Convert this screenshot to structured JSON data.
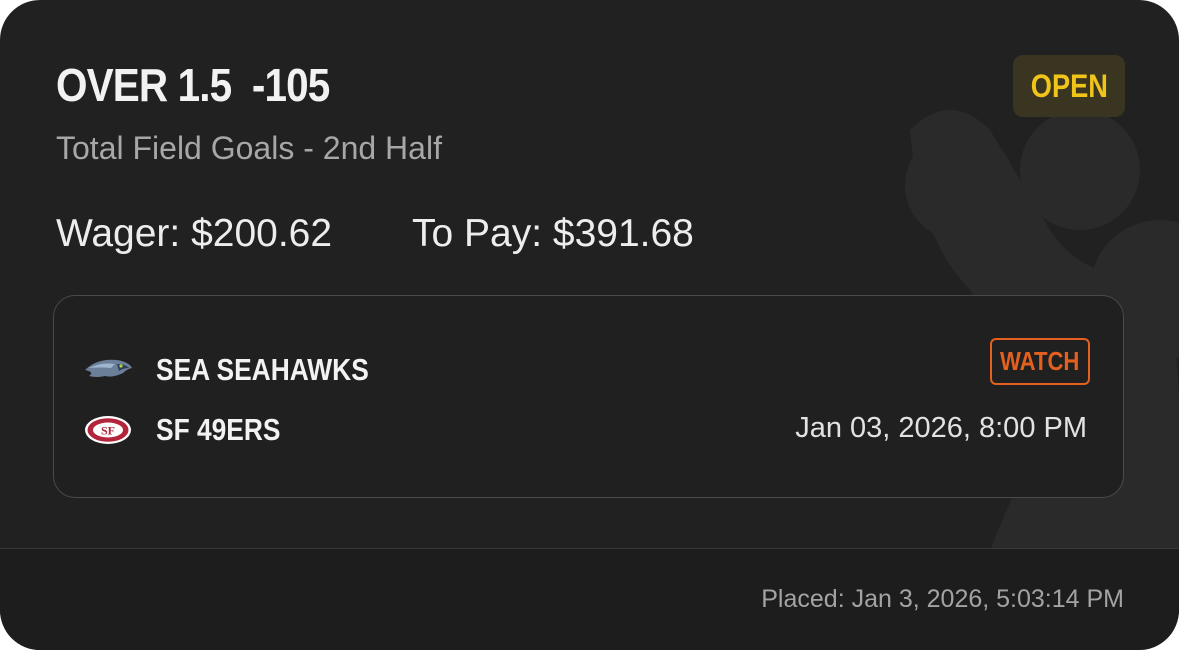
{
  "bet": {
    "title": "OVER 1.5  -105",
    "market": "Total Field Goals - 2nd Half",
    "status": "OPEN",
    "wager": "Wager: $200.62",
    "to_pay": "To Pay: $391.68",
    "placed": "Placed: Jan 3, 2026, 5:03:14 PM"
  },
  "game": {
    "teams": [
      {
        "name": "SEA SEAHAWKS",
        "logo": "seahawks-logo"
      },
      {
        "name": "SF 49ERS",
        "logo": "49ers-logo"
      }
    ],
    "watch_label": "WATCH",
    "datetime": "Jan 03, 2026, 8:00 PM"
  },
  "colors": {
    "card_bg": "#212121",
    "open_text": "#f0c419",
    "open_bg": "#3a3520",
    "watch": "#e4601e"
  },
  "icons": {
    "watermark": "brand-watermark-icon"
  }
}
